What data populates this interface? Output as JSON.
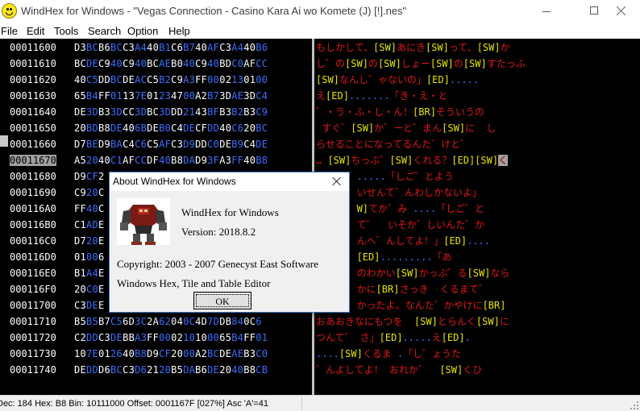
{
  "window": {
    "title": "WindHex for Windows - \"Vegas Connection - Casino Kara Ai wo Komete (J) [!].nes\""
  },
  "menu": [
    "File",
    "Edit",
    "Tools",
    "Search",
    "Option",
    "Help"
  ],
  "hex_rows": [
    {
      "addr": "00011600",
      "bytes": "D3BCB6BCC3A440B1C6B740AFC3A440B6"
    },
    {
      "addr": "00011610",
      "bytes": "BCDEC940C940BCAEB040C940BDC0AFCC"
    },
    {
      "addr": "00011620",
      "bytes": "40C5DDBCDEACC5B2C9A3FF0002130100"
    },
    {
      "addr": "00011630",
      "bytes": "65B4FF0113 7E0123 4700A2B73DAE3DC4"
    },
    {
      "addr": "00011640",
      "bytes": "DE3DB33DCC3DBC3DDD2143BFB3B2B3C9"
    },
    {
      "addr": "00011650",
      "bytes": "20BDB8DE406BDEB0C4DECFDD40C620BC"
    },
    {
      "addr": "00011660",
      "bytes": "D7BED9BAC4C6C5AFC3D9DDC0DEB9C4DE"
    },
    {
      "addr": "00011670",
      "bytes": "A52040C1AFCCDF40B8DAD93FA3FF40B8"
    },
    {
      "addr": "00011680",
      "bytes": "D9CF2"
    },
    {
      "addr": "00011690",
      "bytes": "C920C"
    },
    {
      "addr": "000116A0",
      "bytes": "FF40C"
    },
    {
      "addr": "000116B0",
      "bytes": "C1ADE"
    },
    {
      "addr": "000116C0",
      "bytes": "D720E"
    },
    {
      "addr": "000116D0",
      "bytes": "01006"
    },
    {
      "addr": "000116E0",
      "bytes": "B1A4E"
    },
    {
      "addr": "000116F0",
      "bytes": "20C0E"
    },
    {
      "addr": "00011700",
      "bytes": "C3DEE"
    },
    {
      "addr": "00011710",
      "bytes": "B5B5B7C56D3C2A62040C4D7DDB840C6"
    },
    {
      "addr": "00011720",
      "bytes": "C2DDC3DEBBA3FF000210100065B4FF01"
    },
    {
      "addr": "00011730",
      "bytes": "107E012640B8D9CF2000A2BCDEAEB3C0"
    },
    {
      "addr": "00011740",
      "bytes": "DEDDD6BCC3D6212 0B5DAB6DE2040B8CB"
    }
  ],
  "text_rows": [
    [
      "r|もしかして、",
      "y|[SW]",
      "r|あにき",
      "y|[SW]",
      "r|って、",
      "y|[SW]",
      "r|か"
    ],
    [
      "r|し゛の",
      "y|[SW]",
      "r|の",
      "y|[SW]",
      "r|しょー",
      "y|[SW]",
      "r|の",
      "y|[SW]",
      "r|すたっふ"
    ],
    [
      "y|[SW]",
      "r|なんし゛ゃないの」",
      "y|[ED]",
      "b|....."
    ],
    [
      "r|え",
      "y|[ED]",
      "b|.......",
      "r|「き・え・と"
    ],
    [
      "r|゛・う・ふ・し・ん！",
      "y|[BR]",
      "r|そういうの"
    ],
    [
      "r| すぐ゛",
      "y|[SW]",
      "r|か゛ーと゛まん",
      "y|[SW]",
      "r|に  し"
    ],
    [
      "r|らせることになってるんた゛けと゛"
    ],
    [
      "r|… ",
      "y|[SW]",
      "r|ちっぶ゛",
      "y|[SW]",
      "r|くれる？",
      "y|[ED]",
      "y|[SW]",
      "c|く"
    ],
    [
      "r|       ",
      "b|.....",
      "r|「しご゛とよう"
    ],
    [
      "r|       いせんて゛んわしかないよ」"
    ],
    [
      "r|       ",
      "y|W]",
      "r|てか゛み ",
      "b|....",
      "r|「しご゛と"
    ],
    [
      "r|       て゛  いそか゛しいんた゛か"
    ],
    [
      "r|       んへ゛んしてよ！」",
      "y|[ED]",
      "b|...."
    ],
    [
      "r|       ",
      "y|[ED]",
      "b|.........",
      "r|「あ"
    ],
    [
      "r|       のわかい",
      "y|[SW]",
      "r|かっぶ゛る",
      "y|[SW]",
      "r|なら"
    ],
    [
      "r|       かに",
      "y|[BR]",
      "r|さっき  くるまて゛"
    ],
    [
      "r|       かったよ。なんた゛かやけに",
      "y|[BR]"
    ],
    [
      "r|おあおきなにもつを  ",
      "y|[SW]",
      "r|とらんく",
      "y|[SW]",
      "r|に"
    ],
    [
      "r|つんて゛ さ」",
      "y|[ED]",
      "b|.....",
      "r|え",
      "y|[ED]",
      "b|."
    ],
    [
      "b|....",
      "y|[SW]",
      "r|くるま ",
      "b|.",
      "r|「し゛ょうた"
    ],
    [
      "r|゛んよしてよ！ おれか゛  ",
      "y|[SW]",
      "r|くひ"
    ]
  ],
  "statusbar": {
    "text": "Dec: 184 Hex: B8 Bin: 10111000 Offset: 0001167F [027%] Asc 'A'=41"
  },
  "about_dialog": {
    "title": "About WindHex for Windows",
    "app_name": "WindHex for Windows",
    "version": "Version: 2018.8.2",
    "copyright": "Copyright: 2003 - 2007 Genecyst East Software",
    "description": "Windows Hex, Tile and Table Editor",
    "ok_label": "OK"
  },
  "colors": {
    "hex_address": "#ffffff",
    "hex_byte_alt": "#3b6fff",
    "text_kana": "#e01818",
    "text_control_code": "#e6e600",
    "text_dots": "#3b6fff",
    "dialog_border": "#3c74c4"
  }
}
